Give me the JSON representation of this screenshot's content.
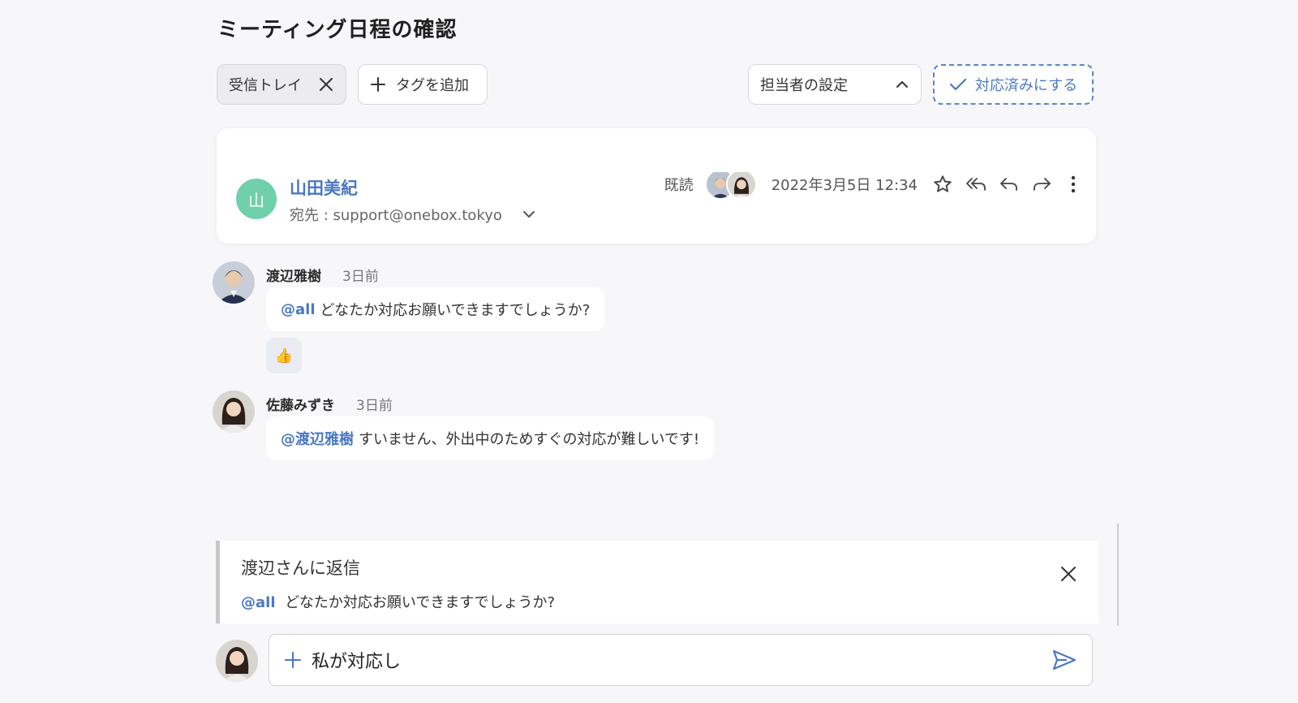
{
  "header": {
    "title": "ミーティング日程の確認"
  },
  "toolbar": {
    "tag_label": "受信トレイ",
    "add_tag_label": "タグを追加",
    "assignee_label": "担当者の設定",
    "resolve_label": "対応済みにする"
  },
  "mail": {
    "avatar_letter": "山",
    "sender": "山田美紀",
    "to": "宛先 : support@onebox.tokyo",
    "read_label": "既読",
    "timestamp": "2022年3月5日 12:34"
  },
  "comments": [
    {
      "name": "渡辺雅樹",
      "time": "3日前",
      "mention": "@all",
      "text": "どなたか対応お願いできますでしょうか?",
      "reaction": "👍"
    },
    {
      "name": "佐藤みずき",
      "time": "3日前",
      "mention": "@渡辺雅樹",
      "text": "すいません、外出中のためすぐの対応が難しいです!"
    }
  ],
  "reply": {
    "title": "渡辺さんに返信",
    "quote_mention": "@all",
    "quote_text": "どなたか対応お願いできますでしょうか?"
  },
  "composer": {
    "value": "私が対応し"
  },
  "colors": {
    "accent": "#4a78c4",
    "avatar_green": "#6fd0ab",
    "background": "#f7f7f9"
  }
}
